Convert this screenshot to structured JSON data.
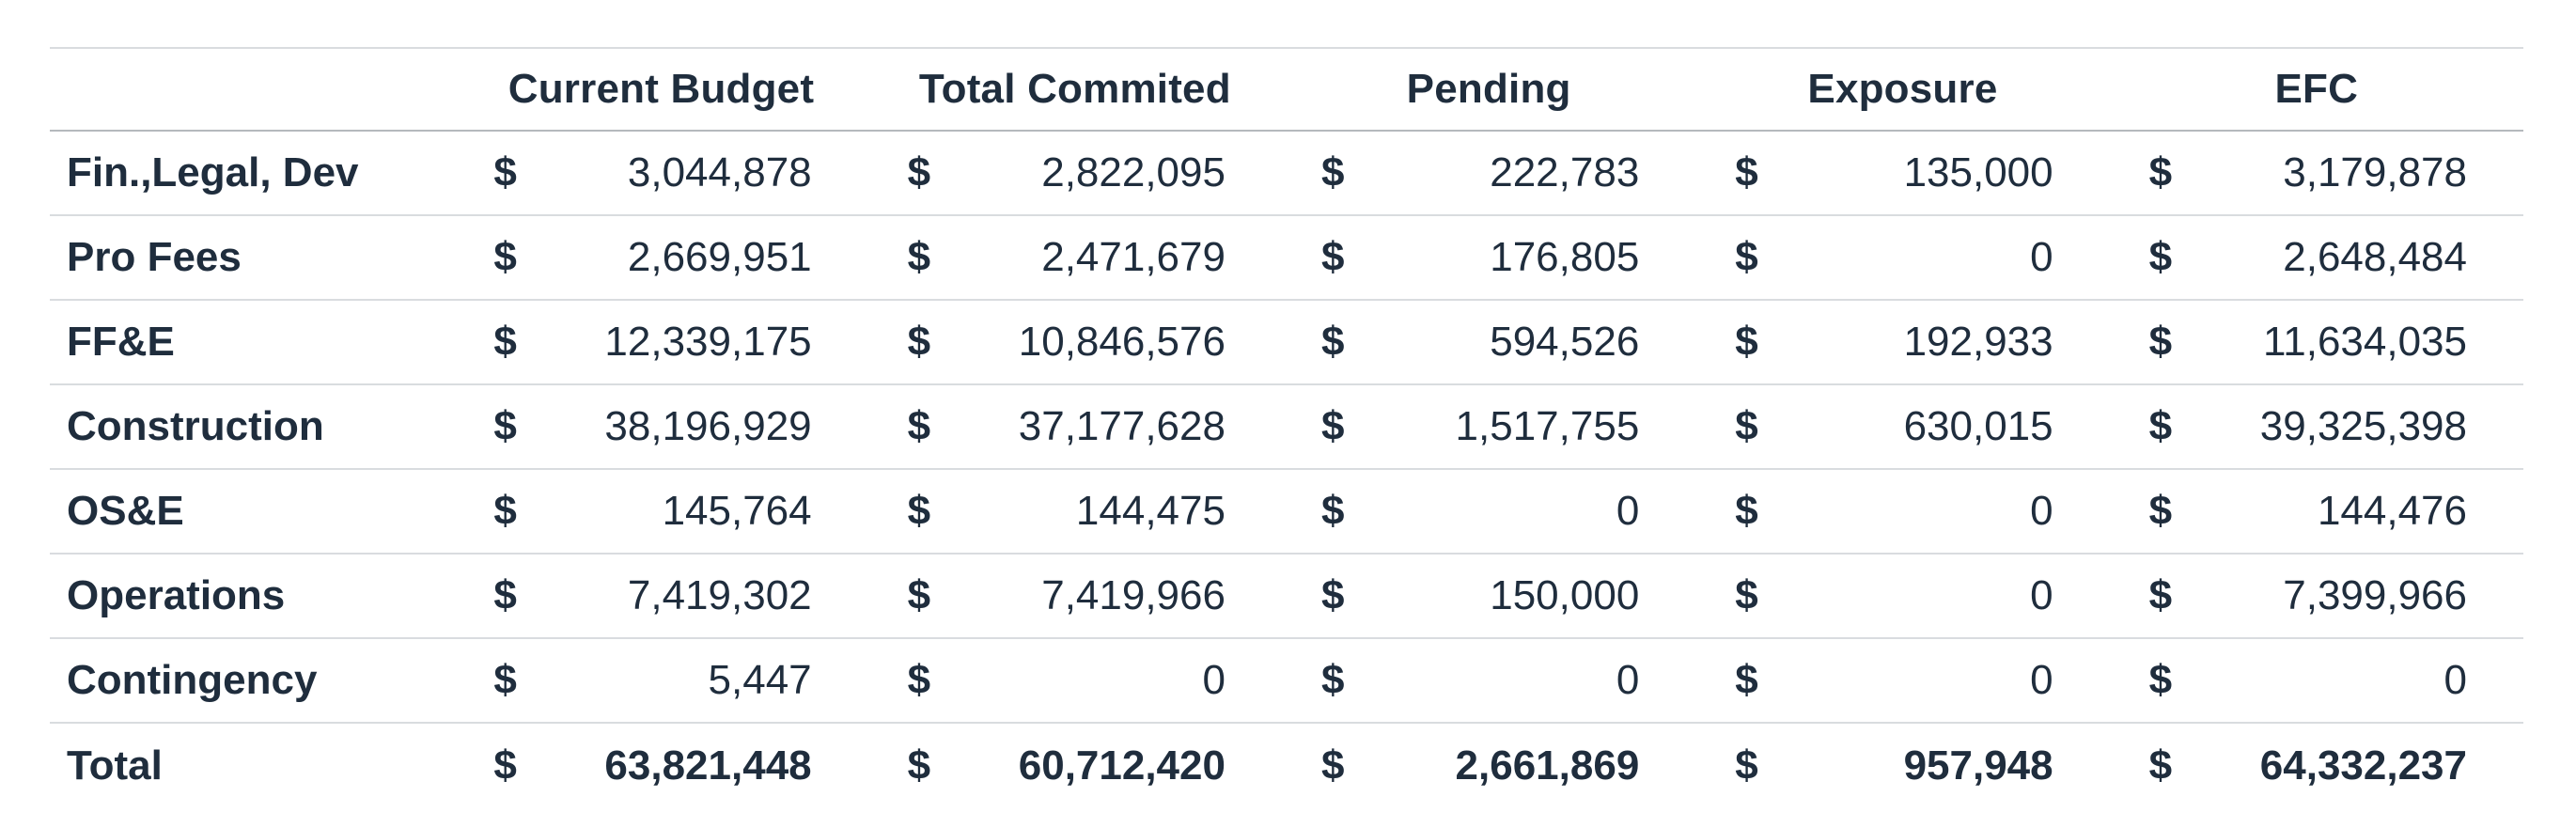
{
  "table": {
    "headers": [
      "",
      "Current Budget",
      "Total Commited",
      "Pending",
      "Exposure",
      "EFC"
    ],
    "currency_symbol": "$",
    "rows": [
      {
        "label": "Fin.,Legal, Dev",
        "values": [
          "3,044,878",
          "2,822,095",
          "222,783",
          "135,000",
          "3,179,878"
        ]
      },
      {
        "label": "Pro Fees",
        "values": [
          "2,669,951",
          "2,471,679",
          "176,805",
          "0",
          "2,648,484"
        ]
      },
      {
        "label": "FF&E",
        "values": [
          "12,339,175",
          "10,846,576",
          "594,526",
          "192,933",
          "11,634,035"
        ]
      },
      {
        "label": "Construction",
        "values": [
          "38,196,929",
          "37,177,628",
          "1,517,755",
          "630,015",
          "39,325,398"
        ]
      },
      {
        "label": "OS&E",
        "values": [
          "145,764",
          "144,475",
          "0",
          "0",
          "144,476"
        ]
      },
      {
        "label": "Operations",
        "values": [
          "7,419,302",
          "7,419,966",
          "150,000",
          "0",
          "7,399,966"
        ]
      },
      {
        "label": "Contingency",
        "values": [
          "5,447",
          "0",
          "0",
          "0",
          "0"
        ]
      }
    ],
    "total": {
      "label": "Total",
      "values": [
        "63,821,448",
        "60,712,420",
        "2,661,869",
        "957,948",
        "64,332,237"
      ]
    }
  },
  "colors": {
    "text": "#1f2d3d",
    "rule": "#d9dcdf",
    "header_rule": "#b5b9bd",
    "background": "#ffffff"
  }
}
